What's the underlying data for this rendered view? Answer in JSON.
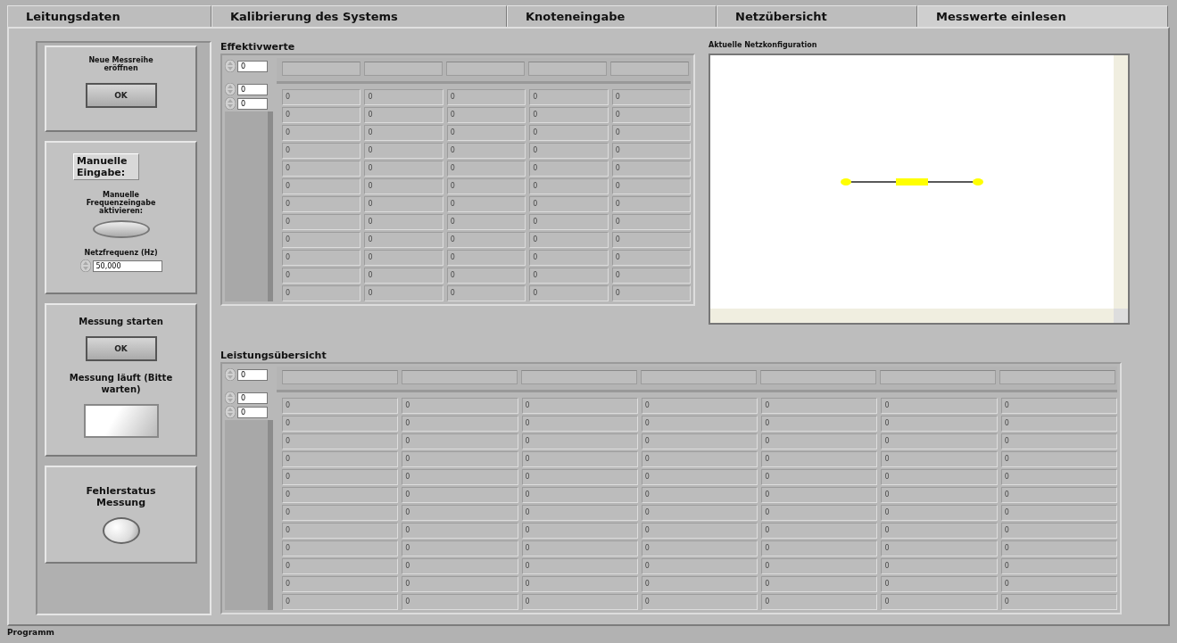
{
  "tabs": [
    {
      "label": "Leitungsdaten",
      "selected": false
    },
    {
      "label": "Kalibrierung des Systems",
      "selected": false
    },
    {
      "label": "Knoteneingabe",
      "selected": false
    },
    {
      "label": "Netzübersicht",
      "selected": false
    },
    {
      "label": "Messwerte einlesen",
      "selected": true
    }
  ],
  "left_panel": [
    {
      "kind": "button",
      "label": "Neue Messreihe eröffnen",
      "button": "OK"
    },
    {
      "kind": "manual",
      "title": "Manuelle Eingabe:",
      "toggle_label": "Manuelle Frequenzeingabe aktivieren:",
      "on": false,
      "field_label": "Netzfrequenz (Hz)",
      "value": "50,000"
    },
    {
      "kind": "start",
      "label": "Messung starten",
      "button": "OK",
      "indicator_label": "Messung läuft (Bitte warten)",
      "on": false
    },
    {
      "kind": "led",
      "label": "Fehlerstatus Messung",
      "on": false
    }
  ],
  "effektivwerte": {
    "title": "Effektivwerte",
    "column_index": "0",
    "row_indices": [
      "0",
      "0"
    ],
    "rows": [
      [
        "0",
        "0",
        "0",
        "0",
        "0"
      ],
      [
        "0",
        "0",
        "0",
        "0",
        "0"
      ],
      [
        "0",
        "0",
        "0",
        "0",
        "0"
      ],
      [
        "0",
        "0",
        "0",
        "0",
        "0"
      ],
      [
        "0",
        "0",
        "0",
        "0",
        "0"
      ],
      [
        "0",
        "0",
        "0",
        "0",
        "0"
      ],
      [
        "0",
        "0",
        "0",
        "0",
        "0"
      ],
      [
        "0",
        "0",
        "0",
        "0",
        "0"
      ],
      [
        "0",
        "0",
        "0",
        "0",
        "0"
      ],
      [
        "0",
        "0",
        "0",
        "0",
        "0"
      ],
      [
        "0",
        "0",
        "0",
        "0",
        "0"
      ],
      [
        "0",
        "0",
        "0",
        "0",
        "0"
      ]
    ]
  },
  "netzkonfiguration": {
    "title": "Aktuelle Netzkonfiguration"
  },
  "leistungsuebersicht": {
    "title": "Leistungsübersicht",
    "column_index": "0",
    "row_indices": [
      "0",
      "0"
    ],
    "rows": [
      [
        "0",
        "0",
        "0",
        "0",
        "0",
        "0",
        "0"
      ],
      [
        "0",
        "0",
        "0",
        "0",
        "0",
        "0",
        "0"
      ],
      [
        "0",
        "0",
        "0",
        "0",
        "0",
        "0",
        "0"
      ],
      [
        "0",
        "0",
        "0",
        "0",
        "0",
        "0",
        "0"
      ],
      [
        "0",
        "0",
        "0",
        "0",
        "0",
        "0",
        "0"
      ],
      [
        "0",
        "0",
        "0",
        "0",
        "0",
        "0",
        "0"
      ],
      [
        "0",
        "0",
        "0",
        "0",
        "0",
        "0",
        "0"
      ],
      [
        "0",
        "0",
        "0",
        "0",
        "0",
        "0",
        "0"
      ],
      [
        "0",
        "0",
        "0",
        "0",
        "0",
        "0",
        "0"
      ],
      [
        "0",
        "0",
        "0",
        "0",
        "0",
        "0",
        "0"
      ],
      [
        "0",
        "0",
        "0",
        "0",
        "0",
        "0",
        "0"
      ],
      [
        "0",
        "0",
        "0",
        "0",
        "0",
        "0",
        "0"
      ]
    ]
  },
  "status_bar": "Programm"
}
